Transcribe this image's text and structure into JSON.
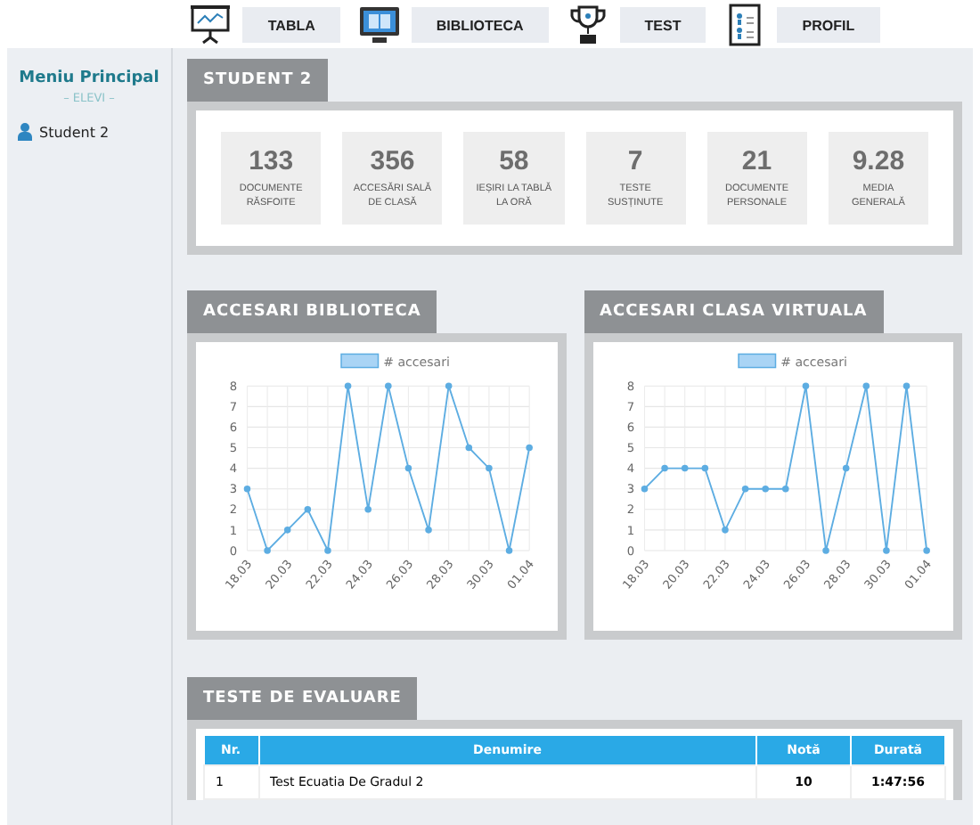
{
  "nav": [
    {
      "label": "TABLA",
      "kind": "board"
    },
    {
      "label": "BIBLIOTECA",
      "kind": "library"
    },
    {
      "label": "TEST",
      "kind": "trophy"
    },
    {
      "label": "PROFIL",
      "kind": "profile"
    }
  ],
  "sidebar": {
    "title": "Meniu Principal",
    "subtitle": "– ELEVI –",
    "items": [
      {
        "label": "Student 2"
      }
    ]
  },
  "student": {
    "title": "STUDENT 2",
    "stats": [
      {
        "value": "133",
        "label": "DOCUMENTE RĂSFOITE"
      },
      {
        "value": "356",
        "label": "ACCESĂRI SALĂ DE CLASĂ"
      },
      {
        "value": "58",
        "label": "IEȘIRI LA TABLĂ LA ORĂ"
      },
      {
        "value": "7",
        "label": "TESTE SUSȚINUTE"
      },
      {
        "value": "21",
        "label": "DOCUMENTE PERSONALE"
      },
      {
        "value": "9.28",
        "label": "MEDIA GENERALĂ"
      }
    ]
  },
  "charts": [
    {
      "title": "ACCESARI BIBLIOTECA",
      "chart_data": {
        "type": "line",
        "categories": [
          "18.03",
          null,
          "20.03",
          null,
          "22.03",
          null,
          "24.03",
          null,
          "26.03",
          null,
          "28.03",
          null,
          "30.03",
          null,
          "01.04"
        ],
        "series": [
          {
            "name": "# accesari",
            "color": "#5dade2",
            "marker": "circle",
            "values": [
              3,
              0,
              1,
              2,
              0,
              8,
              2,
              8,
              4,
              1,
              8,
              5,
              4,
              0,
              5
            ]
          }
        ],
        "grid": true,
        "ylim": [
          0,
          8
        ],
        "yticks": [
          0,
          1,
          2,
          3,
          4,
          5,
          6,
          7,
          8
        ]
      }
    },
    {
      "title": "ACCESARI CLASA VIRTUALA",
      "chart_data": {
        "type": "line",
        "categories": [
          "18.03",
          null,
          "20.03",
          null,
          "22.03",
          null,
          "24.03",
          null,
          "26.03",
          null,
          "28.03",
          null,
          "30.03",
          null,
          "01.04"
        ],
        "series": [
          {
            "name": "# accesari",
            "color": "#5dade2",
            "marker": "circle",
            "values": [
              3,
              4,
              4,
              4,
              1,
              3,
              3,
              3,
              8,
              0,
              4,
              8,
              0,
              8,
              0
            ]
          }
        ],
        "grid": true,
        "ylim": [
          0,
          8
        ],
        "yticks": [
          0,
          1,
          2,
          3,
          4,
          5,
          6,
          7,
          8
        ]
      }
    }
  ],
  "tests": {
    "title": "TESTE DE EVALUARE",
    "columns": [
      "Nr.",
      "Denumire",
      "Notă",
      "Durată"
    ],
    "rows": [
      [
        "1",
        "Test Ecuatia De Gradul 2",
        "10",
        "1:47:56"
      ]
    ]
  }
}
